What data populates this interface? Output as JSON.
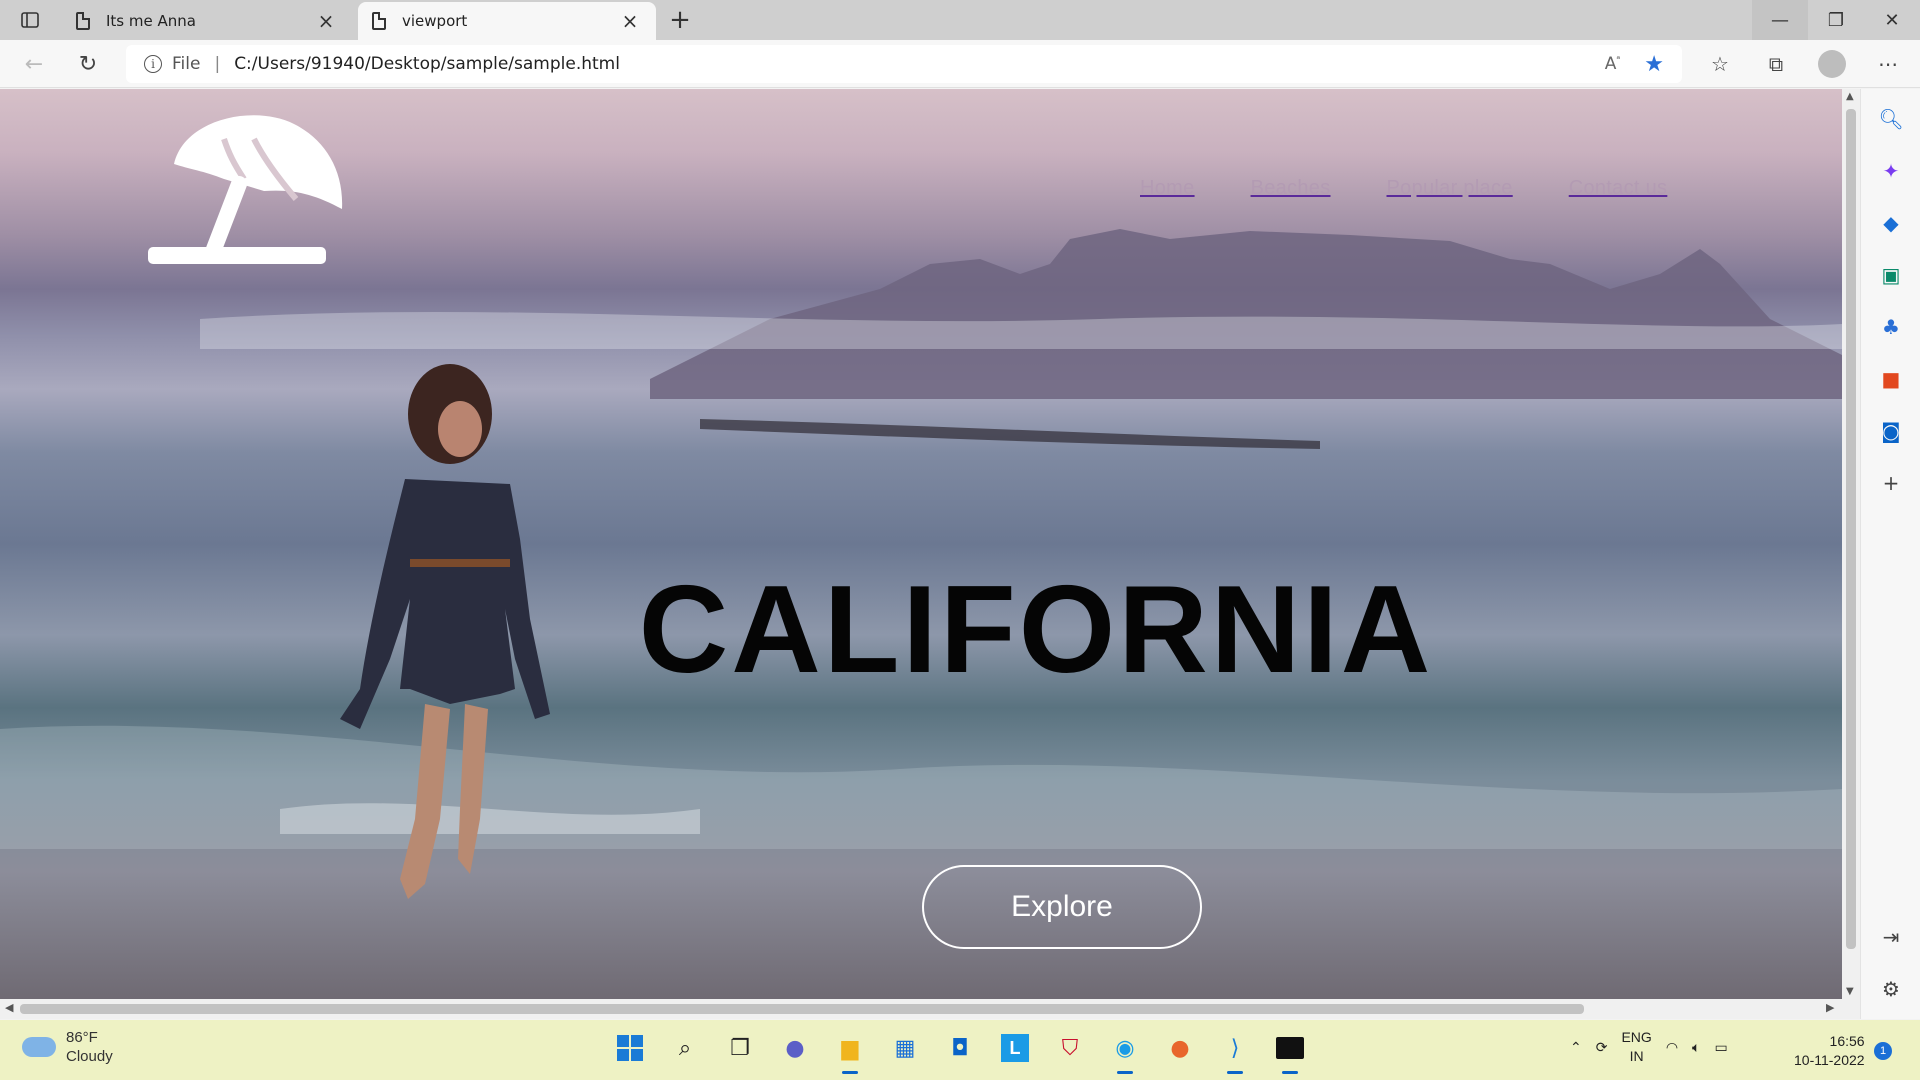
{
  "browser": {
    "tabs": [
      {
        "label": "Its me Anna",
        "active": false
      },
      {
        "label": "viewport",
        "active": true
      }
    ],
    "new_tab": "+",
    "address": {
      "scheme": "File",
      "url": "C:/Users/91940/Desktop/sample/sample.html"
    },
    "window_controls": {
      "minimize": "—",
      "restore": "❐",
      "close": "✕"
    }
  },
  "page": {
    "nav": [
      "Home",
      "Beaches",
      "Popular place",
      "Contact us"
    ],
    "headline": "CALIFORNIA",
    "cta": "Explore"
  },
  "taskbar": {
    "weather": {
      "temp": "86°F",
      "condition": "Cloudy"
    },
    "lang": {
      "line1": "ENG",
      "line2": "IN"
    },
    "clock": {
      "time": "16:56",
      "date": "10-11-2022"
    },
    "notifications": "1"
  },
  "colors": {
    "accent": "#2a6fd6",
    "nav_text": "#b39bb3",
    "headline": "#050505",
    "taskbar": "#eef2c4"
  }
}
